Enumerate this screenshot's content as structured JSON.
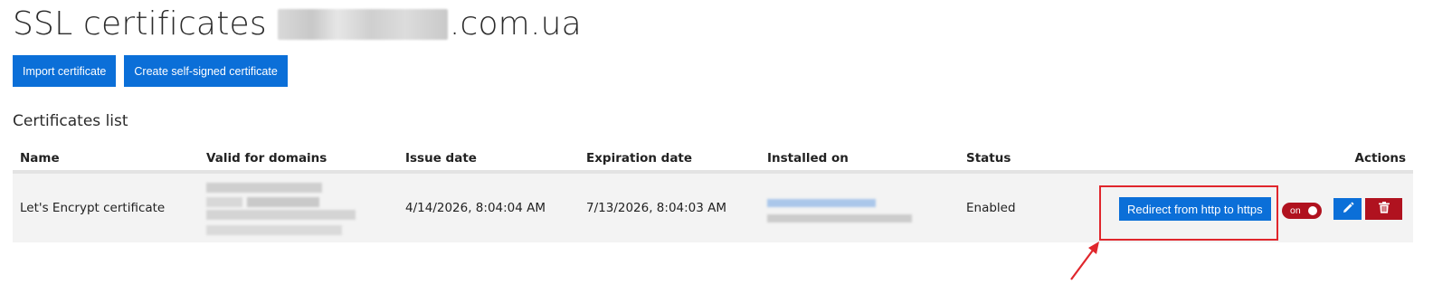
{
  "page": {
    "title_prefix": "SSL certificates",
    "title_suffix": ".com.ua"
  },
  "toolbar": {
    "import_label": "Import certificate",
    "self_signed_label": "Create self-signed certificate"
  },
  "section": {
    "title": "Certificates list"
  },
  "table": {
    "columns": [
      "Name",
      "Valid for domains",
      "Issue date",
      "Expiration date",
      "Installed on",
      "Status",
      "Actions"
    ],
    "rows": [
      {
        "name": "Let's Encrypt certificate",
        "issue_date": "4/14/2026, 8:04:04 AM",
        "expiration_date": "7/13/2026, 8:04:03 AM",
        "status": "Enabled",
        "redirect_label": "Redirect from http to https",
        "toggle_label": "on"
      }
    ]
  },
  "icons": {
    "edit": "pencil-icon",
    "delete": "trash-icon"
  },
  "colors": {
    "primary": "#0b6fd8",
    "danger": "#b0121f",
    "highlight": "#e0262c"
  }
}
